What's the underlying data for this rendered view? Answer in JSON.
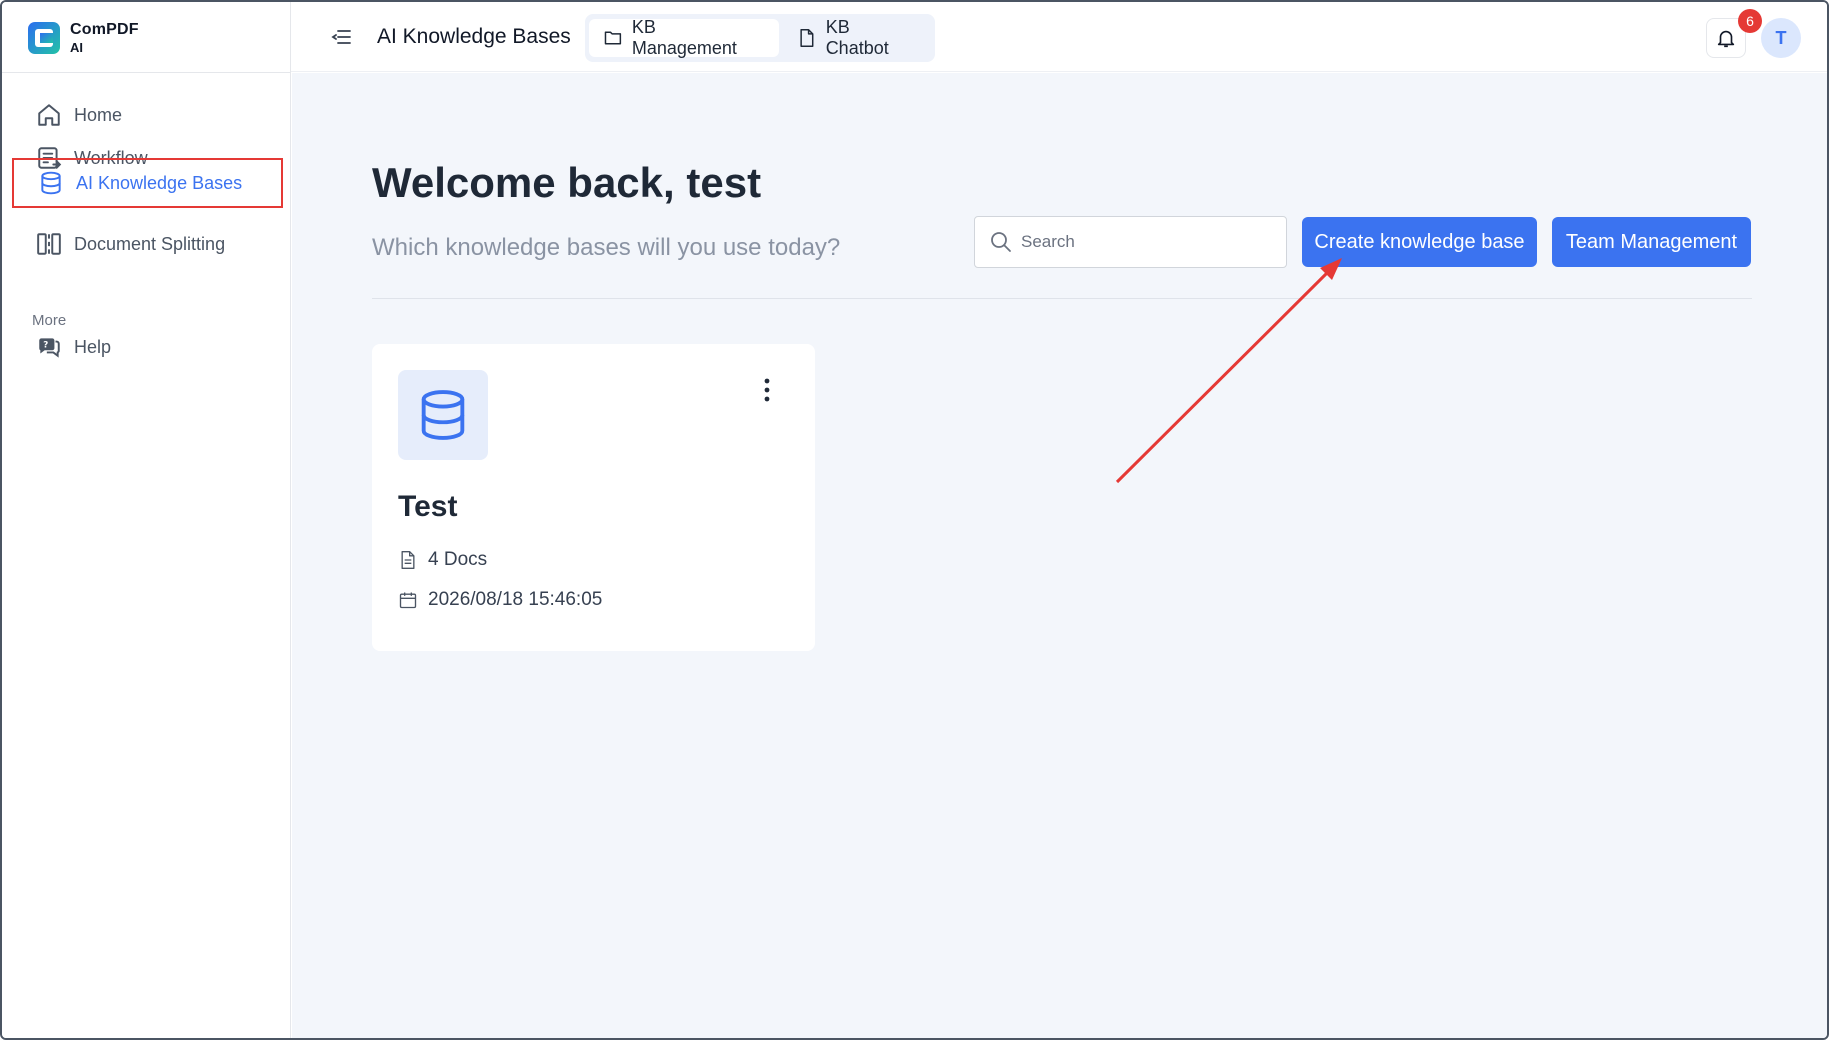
{
  "app": {
    "brand": "ComPDF",
    "brand_sub": "AI"
  },
  "sidebar": {
    "items": [
      {
        "label": "Home",
        "icon": "home-icon"
      },
      {
        "label": "Workflow",
        "icon": "workflow-icon"
      },
      {
        "label": "AI Knowledge Bases",
        "icon": "database-icon",
        "active": true
      },
      {
        "label": "Document Splitting",
        "icon": "split-icon"
      }
    ],
    "section_more": "More",
    "more_items": [
      {
        "label": "Help",
        "icon": "help-icon"
      }
    ]
  },
  "header": {
    "title": "AI Knowledge Bases",
    "tabs": [
      {
        "label": "KB Management",
        "icon": "folder-icon",
        "active": true
      },
      {
        "label": "KB Chatbot",
        "icon": "document-icon",
        "active": false
      }
    ],
    "notification_count": "6",
    "avatar_initial": "T"
  },
  "main": {
    "welcome": "Welcome back, test",
    "subtitle": "Which knowledge bases will you use today?",
    "search_placeholder": "Search",
    "create_button": "Create knowledge base",
    "team_button": "Team Management",
    "cards": [
      {
        "title": "Test",
        "docs": "4 Docs",
        "date": "2026/08/18 15:46:05"
      }
    ]
  },
  "colors": {
    "accent": "#3b73f0",
    "highlight_border": "#e53935",
    "annotation_arrow": "#e53935"
  }
}
